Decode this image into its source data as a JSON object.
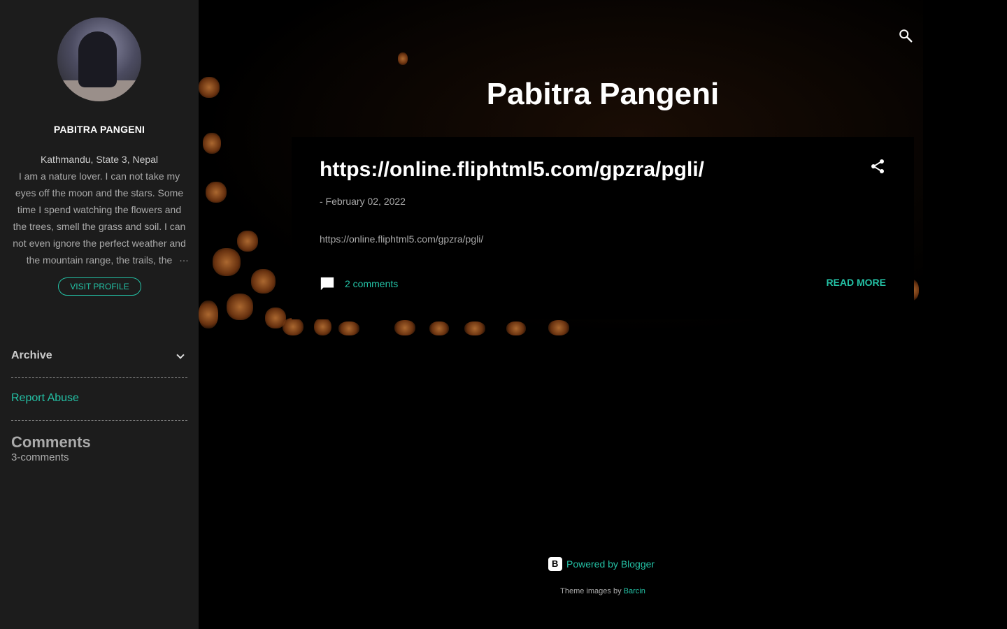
{
  "sidebar": {
    "profile_name": "PABITRA PANGENI",
    "location": "Kathmandu, State 3, Nepal",
    "about": "I am a nature lover. I can not take my eyes off the moon and the stars. Some time I spend watching the flowers and the trees, smell the grass and soil. I can not even ignore the perfect weather and the mountain range, the trails, the",
    "about_ellipsis": "…",
    "visit_profile_label": "VISIT PROFILE",
    "archive_label": "Archive",
    "report_abuse_label": "Report Abuse",
    "comments_title": "Comments",
    "comments_count": "3-comments"
  },
  "header": {
    "blog_title": "Pabitra Pangeni"
  },
  "post": {
    "title": "https://online.fliphtml5.com/gpzra/pgli/",
    "date": "- February 02, 2022",
    "body": "https://online.fliphtml5.com/gpzra/pgli/",
    "comments_label": "2 comments",
    "read_more_label": "READ MORE"
  },
  "footer": {
    "powered_by": "Powered by Blogger",
    "theme_images_prefix": "Theme images by",
    "theme_images_author": "Barcin"
  },
  "icons": {
    "search": "search-icon",
    "share": "share-icon",
    "comment": "comment-icon",
    "chevron": "chevron-down-icon",
    "blogger": "blogger-logo-icon"
  },
  "colors": {
    "accent": "#24c2a6",
    "sidebar_bg": "#1c1c1c",
    "page_bg": "#000000",
    "bokeh": "#c97a38"
  }
}
